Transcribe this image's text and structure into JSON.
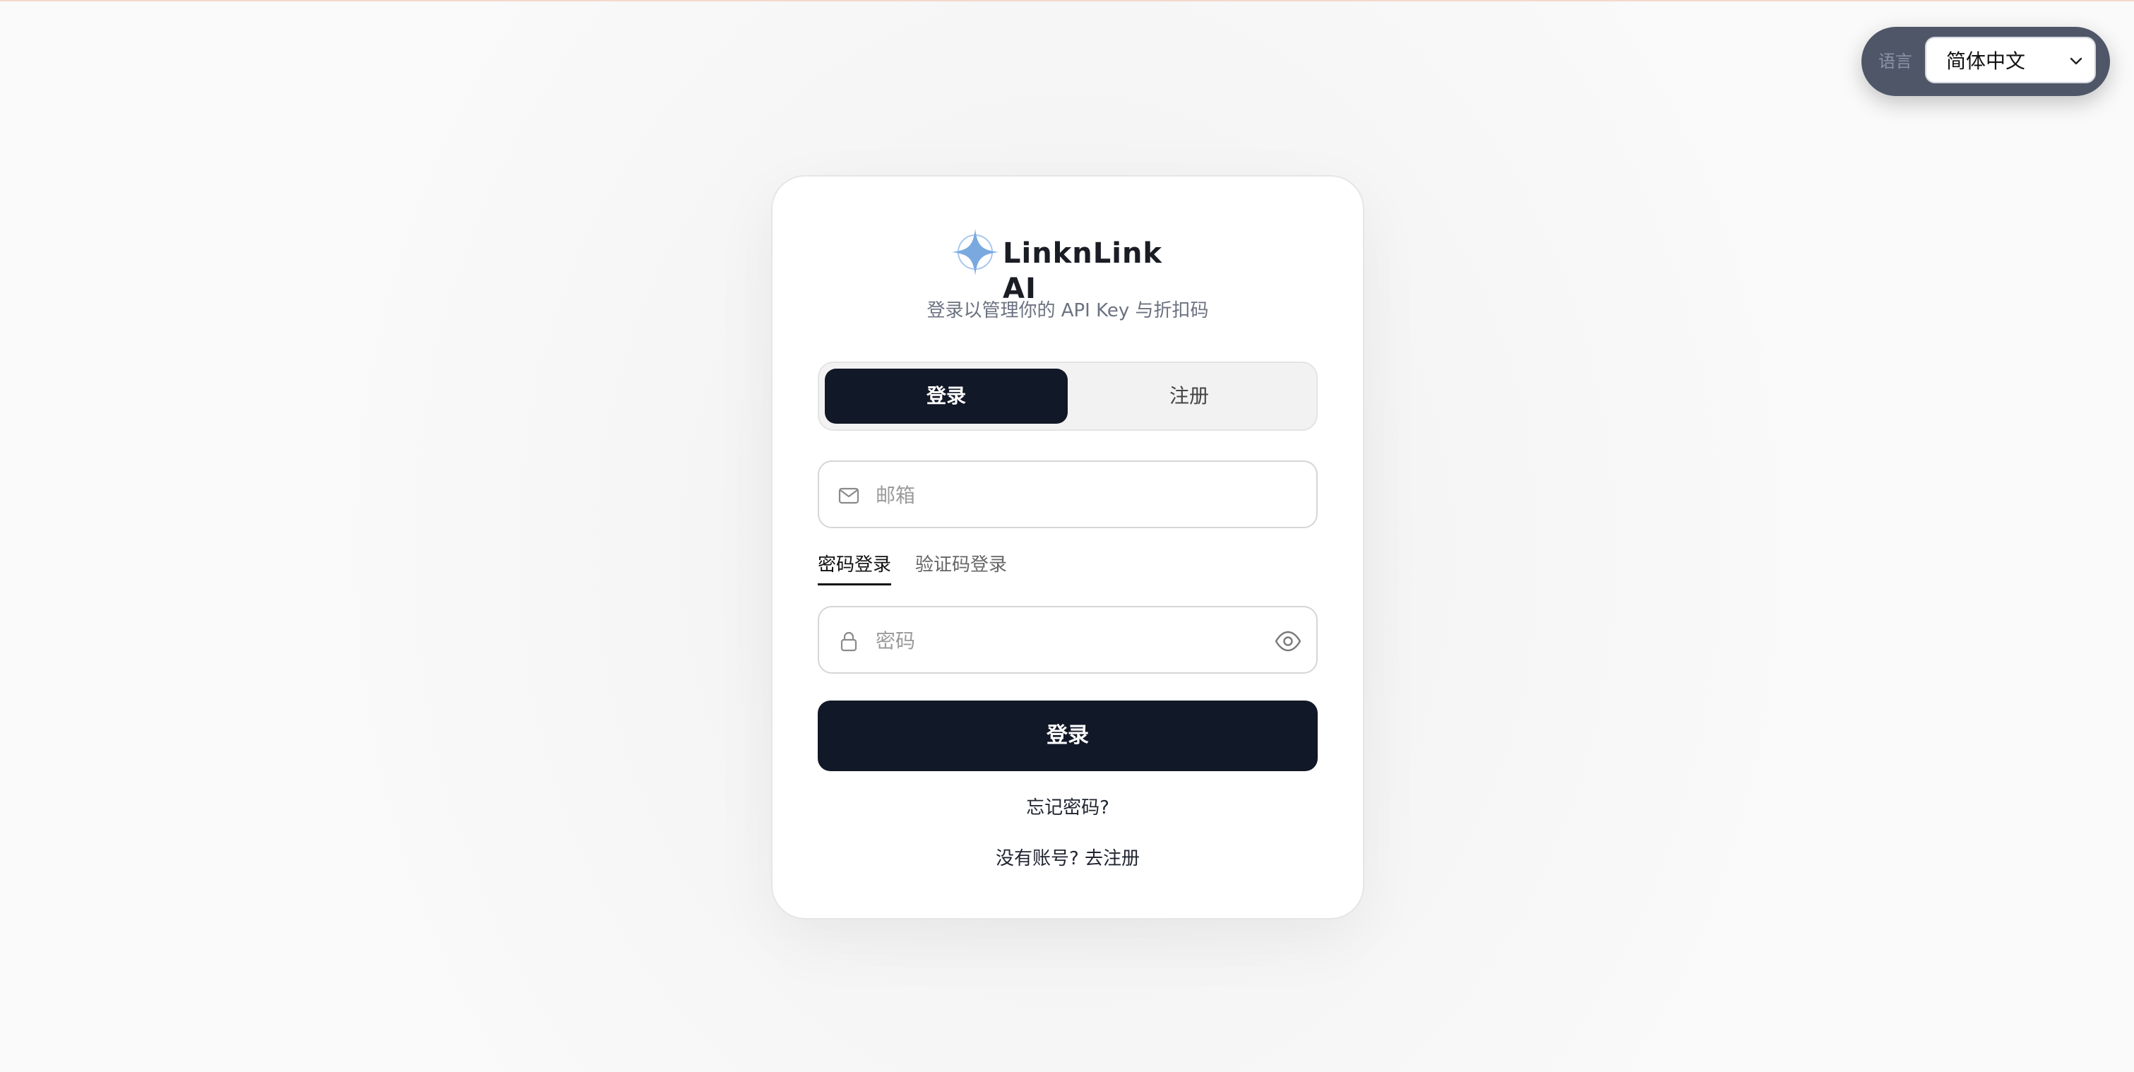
{
  "language": {
    "label": "语言",
    "selected": "简体中文"
  },
  "brand": {
    "name": "LinknLink AI",
    "logo_icon": "four-point-star-icon",
    "logo_color": "#7aa9e0"
  },
  "subtitle": "登录以管理你的 API Key 与折扣码",
  "mode_tabs": {
    "login": "登录",
    "register": "注册"
  },
  "email": {
    "placeholder": "邮箱",
    "value": "",
    "icon": "mail-icon"
  },
  "method_tabs": {
    "password": "密码登录",
    "code": "验证码登录"
  },
  "password": {
    "placeholder": "密码",
    "value": "",
    "icon": "lock-icon",
    "toggle_icon": "eye-icon"
  },
  "submit_label": "登录",
  "forgot_label": "忘记密码?",
  "signup_prompt": "没有账号?",
  "signup_link": "去注册",
  "colors": {
    "primary": "#111827",
    "pill": "#4f5668"
  }
}
